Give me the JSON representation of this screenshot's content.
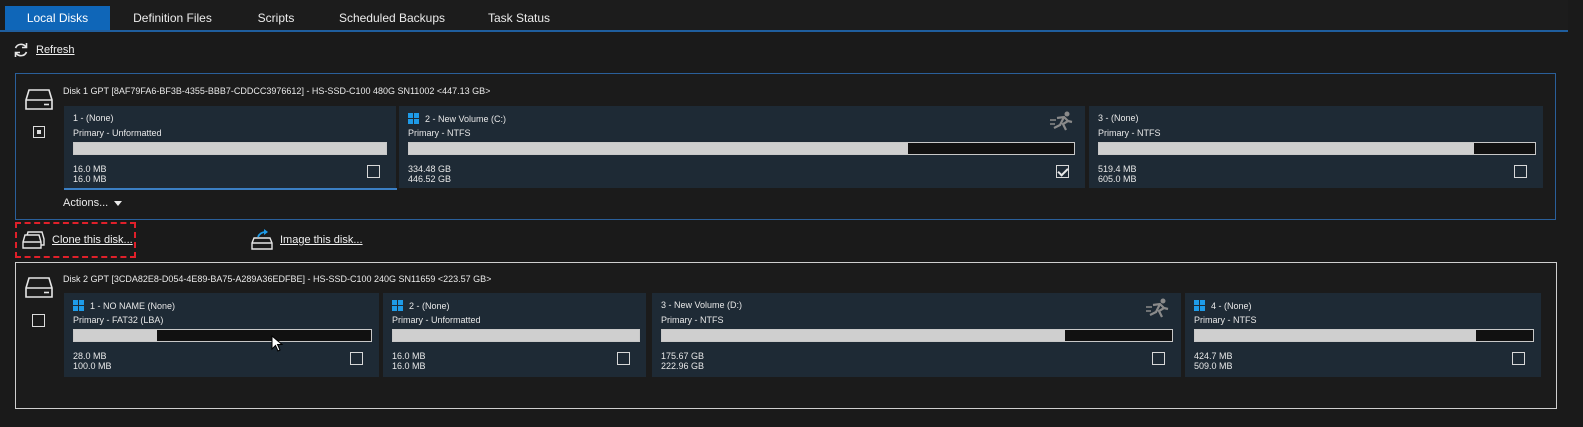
{
  "tabs": [
    {
      "label": "Local Disks",
      "active": true
    },
    {
      "label": "Definition Files",
      "active": false
    },
    {
      "label": "Scripts",
      "active": false
    },
    {
      "label": "Scheduled Backups",
      "active": false
    },
    {
      "label": "Task Status",
      "active": false
    }
  ],
  "toolbar": {
    "refresh_label": "Refresh",
    "refresh_icon": "refresh-icon"
  },
  "colors": {
    "accent": "#0f66b8",
    "partition_bg": "#1e2a35",
    "windows_logo": "#1e9be8",
    "highlight": "#e0202a"
  },
  "disk1": {
    "title": "Disk 1 GPT [8AF79FA6-BF3B-4355-BBB7-CDDCC3976612] - HS-SSD-C100 480G SN11002  <447.13 GB>",
    "checkbox_state": "partial",
    "partitions": [
      {
        "name": "1 -  (None)",
        "type": "Primary - Unformatted",
        "used": "16.0 MB",
        "total": "16.0 MB",
        "fill": 1.0,
        "checked": false,
        "windows": false,
        "system": false
      },
      {
        "name": "2 - New Volume (C:)",
        "type": "Primary - NTFS",
        "used": "334.48 GB",
        "total": "446.52 GB",
        "fill": 0.75,
        "checked": true,
        "windows": true,
        "system": true
      },
      {
        "name": "3 -  (None)",
        "type": "Primary - NTFS",
        "used": "519.4 MB",
        "total": "605.0 MB",
        "fill": 0.86,
        "checked": false,
        "windows": false,
        "system": false
      }
    ],
    "actions_label": "Actions..."
  },
  "links": {
    "clone": "Clone this disk...",
    "image": "Image this disk..."
  },
  "disk2": {
    "title": "Disk 2 GPT [3CDA82E8-D054-4E89-BA75-A289A36EDFBE] - HS-SSD-C100 240G SN11659  <223.57 GB>",
    "checkbox_state": "unchecked",
    "partitions": [
      {
        "name": "1 - NO NAME (None)",
        "type": "Primary - FAT32 (LBA)",
        "used": "28.0 MB",
        "total": "100.0 MB",
        "fill": 0.28,
        "checked": false,
        "windows": true,
        "system": false
      },
      {
        "name": "2 -  (None)",
        "type": "Primary - Unformatted",
        "used": "16.0 MB",
        "total": "16.0 MB",
        "fill": 1.0,
        "checked": false,
        "windows": true,
        "system": false
      },
      {
        "name": "3 - New Volume (D:)",
        "type": "Primary - NTFS",
        "used": "175.67 GB",
        "total": "222.96 GB",
        "fill": 0.79,
        "checked": false,
        "windows": false,
        "system": true
      },
      {
        "name": "4 -  (None)",
        "type": "Primary - NTFS",
        "used": "424.7 MB",
        "total": "509.0 MB",
        "fill": 0.83,
        "checked": false,
        "windows": true,
        "system": false
      }
    ]
  }
}
